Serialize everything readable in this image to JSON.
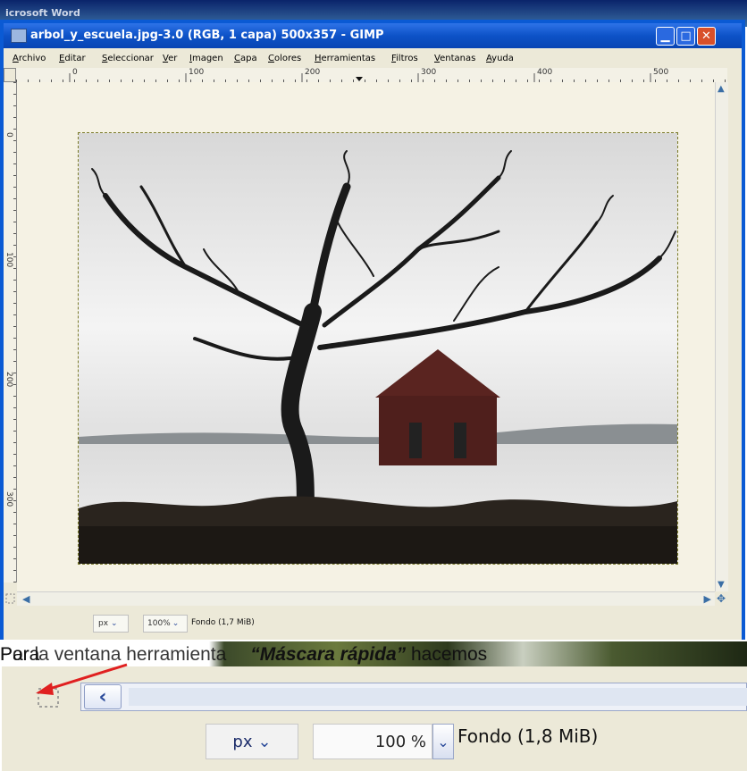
{
  "background_app": {
    "title": "icrosoft Word"
  },
  "window": {
    "title": "arbol_y_escuela.jpg-3.0 (RGB, 1 capa) 500x357 - GIMP",
    "minimize_icon": "minimize-icon",
    "maximize_icon": "maximize-icon",
    "close_icon": "close-icon"
  },
  "menu": [
    "Archivo",
    "Editar",
    "Seleccionar",
    "Ver",
    "Imagen",
    "Capa",
    "Colores",
    "Herramientas",
    "Filtros",
    "Ventanas",
    "Ayuda"
  ],
  "ruler": {
    "h_ticks": [
      "0",
      "100",
      "200",
      "300",
      "400",
      "500"
    ],
    "v_ticks": [
      "0",
      "100",
      "200",
      "300"
    ]
  },
  "status": {
    "unit": "px",
    "zoom": "100%",
    "layer": "Fondo (1,7 MiB)"
  },
  "caption": {
    "prefix": "Para ",
    "highlight": "“Máscara rápida”",
    "suffix": " hacemos",
    "overlap": "Por la ventana herramienta"
  },
  "zoom_detail": {
    "unit": "px",
    "zoom": "100 %",
    "layer": "Fondo (1,8 MiB)"
  },
  "colors": {
    "titlebar": "#0d52c7",
    "close": "#d8502a",
    "arrow": "#e02020"
  }
}
